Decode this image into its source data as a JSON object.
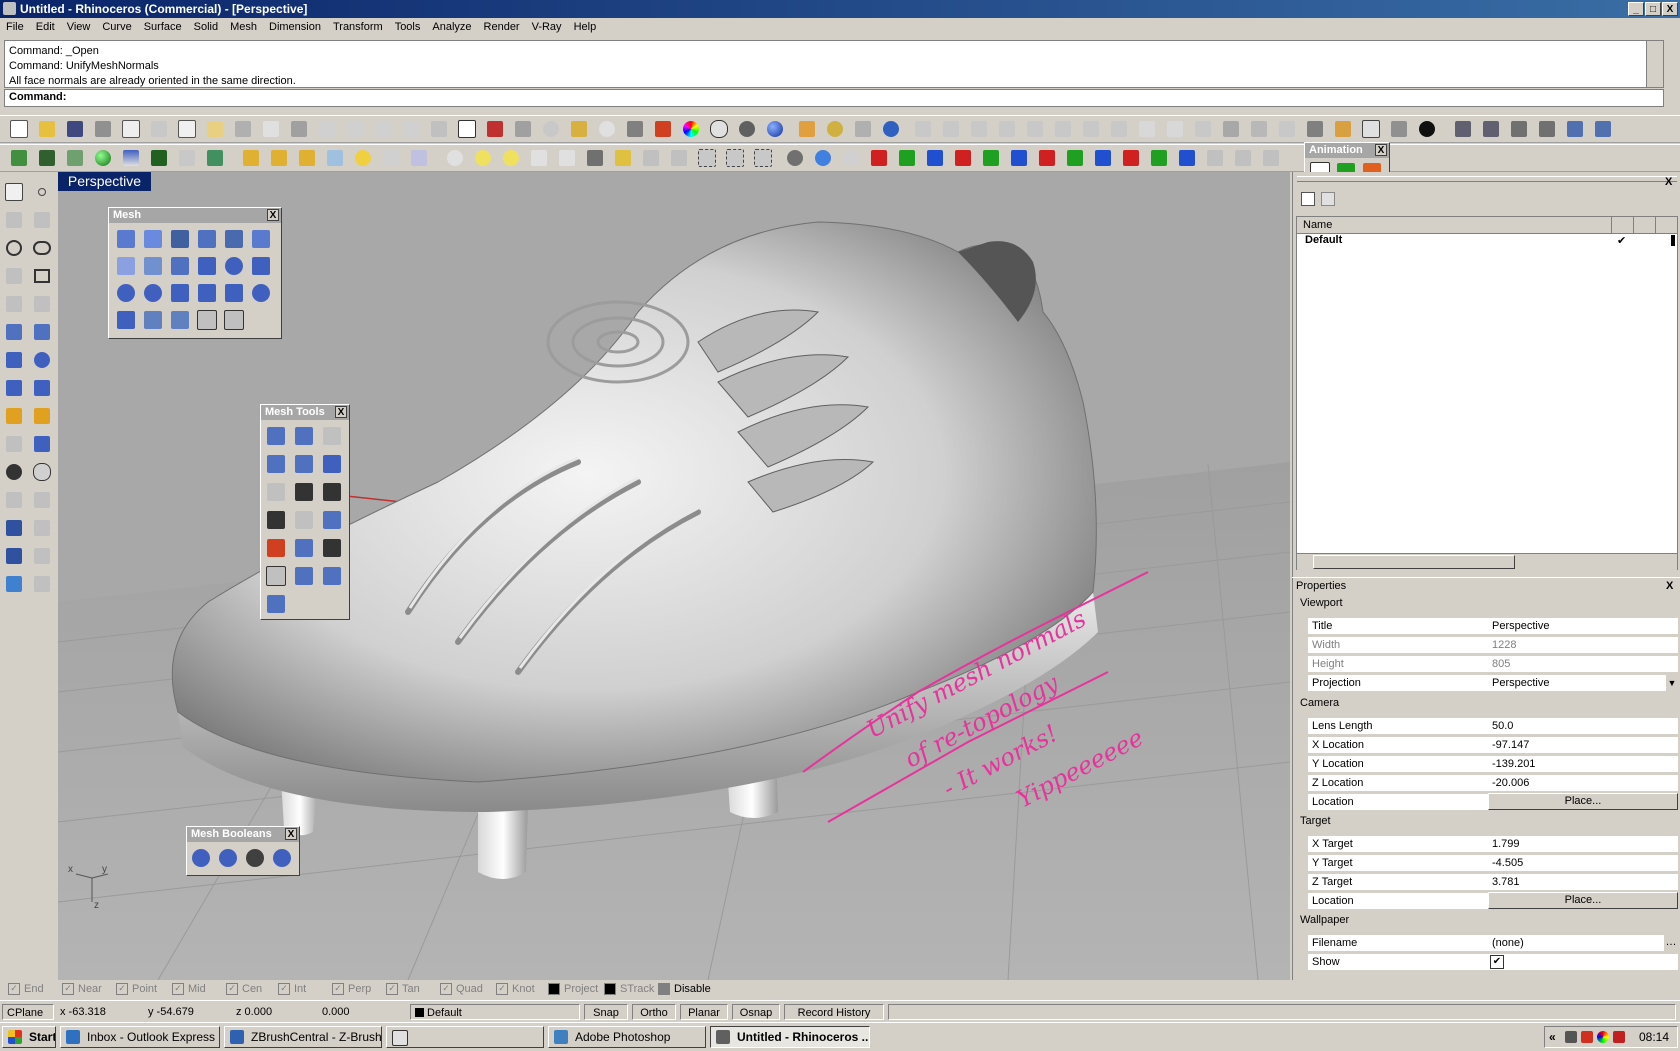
{
  "window": {
    "title": "Untitled - Rhinoceros (Commercial) - [Perspective]",
    "buttons": [
      "_",
      "□",
      "X"
    ]
  },
  "menu": [
    "File",
    "Edit",
    "View",
    "Curve",
    "Surface",
    "Solid",
    "Mesh",
    "Dimension",
    "Transform",
    "Tools",
    "Analyze",
    "Render",
    "V-Ray",
    "Help"
  ],
  "command": {
    "history": [
      "Command: _Open",
      "Command: UnifyMeshNormals",
      "All face normals are already oriented in the same direction."
    ],
    "prompt": "Command:"
  },
  "viewport": {
    "title": "Perspective",
    "axes": {
      "x": "x",
      "y": "y",
      "z": "z"
    },
    "annotation": [
      "Unify mesh normals",
      "of re-topology",
      "- It works!",
      "Yippeeeeee"
    ]
  },
  "palettes": {
    "mesh": "Mesh",
    "mesh_tools": "Mesh Tools",
    "mesh_booleans": "Mesh Booleans",
    "animation": "Animation",
    "close": "X"
  },
  "layers": {
    "column_name": "Name",
    "rows": [
      {
        "name": "Default",
        "check": "✔"
      }
    ]
  },
  "properties": {
    "header": "Properties",
    "close": "X",
    "viewport_group": "Viewport",
    "viewport_rows": [
      {
        "k": "Title",
        "v": "Perspective"
      },
      {
        "k": "Width",
        "v": "1228"
      },
      {
        "k": "Height",
        "v": "805"
      },
      {
        "k": "Projection",
        "v": "Perspective"
      }
    ],
    "camera_group": "Camera",
    "camera_rows": [
      {
        "k": "Lens Length",
        "v": "50.0"
      },
      {
        "k": "X Location",
        "v": "-97.147"
      },
      {
        "k": "Y Location",
        "v": "-139.201"
      },
      {
        "k": "Z Location",
        "v": "-20.006"
      },
      {
        "k": "Location",
        "v": "Place..."
      }
    ],
    "target_group": "Target",
    "target_rows": [
      {
        "k": "X Target",
        "v": "1.799"
      },
      {
        "k": "Y Target",
        "v": "-4.505"
      },
      {
        "k": "Z Target",
        "v": "3.781"
      },
      {
        "k": "Location",
        "v": "Place..."
      }
    ],
    "wallpaper_group": "Wallpaper",
    "wallpaper_rows": [
      {
        "k": "Filename",
        "v": "(none)"
      },
      {
        "k": "Show",
        "v": "✔"
      }
    ]
  },
  "osnap": [
    "End",
    "Near",
    "Point",
    "Mid",
    "Cen",
    "Int",
    "Perp",
    "Tan",
    "Quad",
    "Knot",
    "Project",
    "STrack",
    "Disable"
  ],
  "status": {
    "cplane": "CPlane",
    "x": "x -63.318",
    "y": "y -54.679",
    "z": "z 0.000",
    "d": "0.000",
    "layer": "Default",
    "toggles": [
      "Snap",
      "Ortho",
      "Planar",
      "Osnap",
      "Record History"
    ]
  },
  "taskbar": {
    "start": "Start",
    "tasks": [
      "Inbox - Outlook Express",
      "ZBrushCentral - Z-Brush ...",
      "",
      "Adobe Photoshop",
      "Untitled - Rhinoceros ..."
    ],
    "clock": "08:14",
    "tray_chevron": "«"
  },
  "colors": {
    "titlebar": "#0a246a",
    "viewport_bg": "#a4a4a4",
    "annotation": "#e8329c"
  }
}
